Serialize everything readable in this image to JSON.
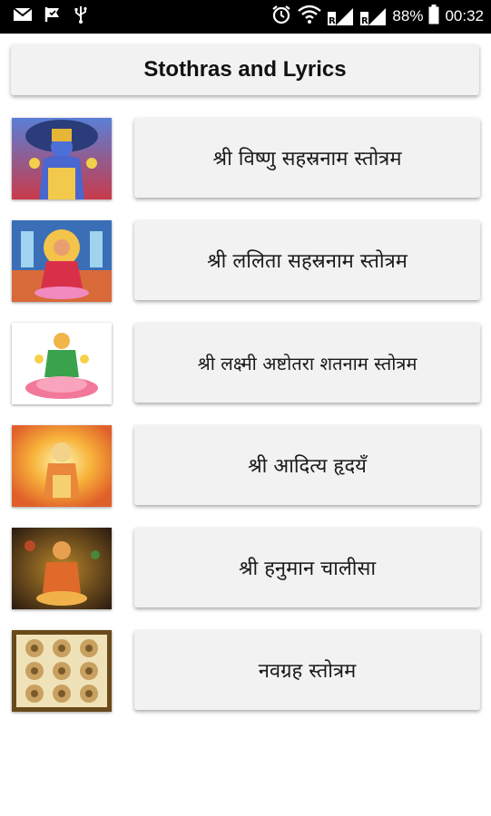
{
  "status_bar": {
    "battery": "88%",
    "time": "00:32",
    "signal_label": "R"
  },
  "header": {
    "title": "Stothras and Lyrics"
  },
  "items": [
    {
      "label": "श्री विष्णु सहस्रनाम स्तोत्रम",
      "image": "vishnu-image"
    },
    {
      "label": "श्री ललिता सहस्रनाम स्तोत्रम",
      "image": "lalitha-image"
    },
    {
      "label": "श्री लक्ष्मी अष्टोतरा शतनाम स्तोत्रम",
      "image": "lakshmi-image"
    },
    {
      "label": "श्री आदित्य हृदयँ",
      "image": "aditya-image"
    },
    {
      "label": "श्री हनुमान चालीसा",
      "image": "hanuman-image"
    },
    {
      "label": "नवग्रह स्तोत्रम",
      "image": "navagraha-image"
    }
  ],
  "colors": {
    "card_bg": "#f2f2f2",
    "status_bg": "#000000"
  }
}
